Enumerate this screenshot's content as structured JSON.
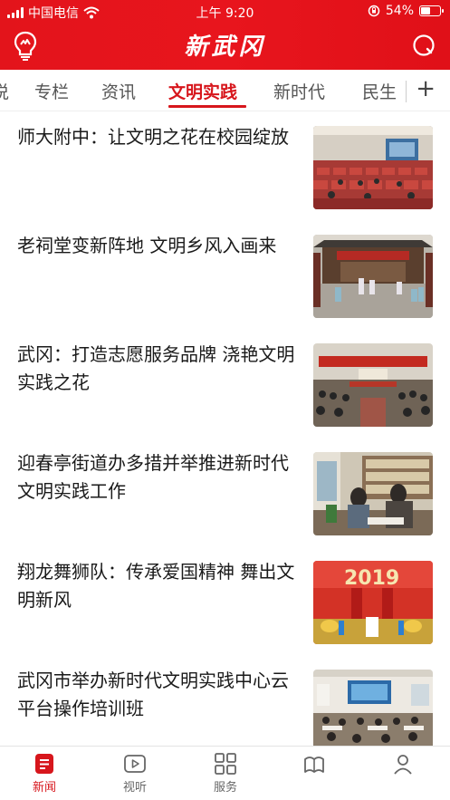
{
  "status_bar": {
    "carrier": "中国电信",
    "time": "上午 9:20",
    "battery": "54%",
    "battery_level": 0.54
  },
  "header": {
    "title": "新武冈",
    "logo_icon": "bulb-icon",
    "search_icon": "search-icon",
    "brand_color": "#e3141b"
  },
  "tabs": {
    "items": [
      "说",
      "专栏",
      "资讯",
      "文明实践",
      "新时代",
      "民生"
    ],
    "active": "文明实践",
    "add_icon": "plus-icon"
  },
  "news": [
    {
      "title": "师大附中：让文明之花在校园绽放"
    },
    {
      "title": "老祠堂变新阵地 文明乡风入画来"
    },
    {
      "title": "武冈：打造志愿服务品牌 浇艳文明实践之花"
    },
    {
      "title": "迎春亭街道办多措并举推进新时代文明实践工作"
    },
    {
      "title": "翔龙舞狮队：传承爱国精神 舞出文明新风"
    },
    {
      "title": "武冈市举办新时代文明实践中心云平台操作培训班"
    }
  ],
  "thumb_texts": {
    "stage_2019": "2019"
  },
  "tabbar": {
    "items": [
      {
        "label": "新闻",
        "icon": "news-icon",
        "active": true
      },
      {
        "label": "视听",
        "icon": "play-icon",
        "active": false
      },
      {
        "label": "服务",
        "icon": "grid-icon",
        "active": false
      },
      {
        "label": "",
        "icon": "book-icon",
        "active": false
      },
      {
        "label": "",
        "icon": "person-icon",
        "active": false
      }
    ]
  },
  "colors": {
    "accent": "#d7161c",
    "text": "#1a1a1a",
    "muted": "#555555"
  }
}
